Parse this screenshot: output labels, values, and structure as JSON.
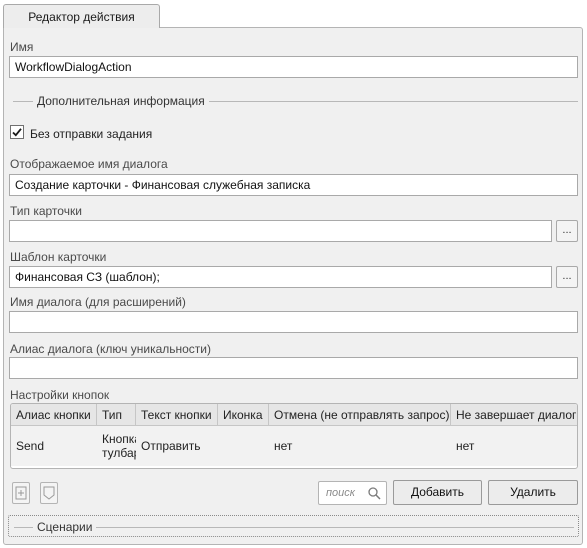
{
  "tab": {
    "label": "Редактор действия"
  },
  "name_field": {
    "label": "Имя",
    "value": "WorkflowDialogAction"
  },
  "extra_section": {
    "title": "Дополнительная информация"
  },
  "no_task_checkbox": {
    "label": "Без отправки задания",
    "checked": true
  },
  "dialog_display_name": {
    "label": "Отображаемое имя диалога",
    "value": "Создание карточки - Финансовая служебная записка"
  },
  "card_type": {
    "label": "Тип карточки",
    "value": "",
    "browse_label": "..."
  },
  "card_template": {
    "label": "Шаблон карточки",
    "value": "Финансовая СЗ (шаблон);",
    "browse_label": "..."
  },
  "dialog_name_ext": {
    "label": "Имя диалога (для расширений)",
    "value": ""
  },
  "dialog_alias": {
    "label": "Алиас диалога (ключ уникальности)",
    "value": ""
  },
  "buttons_settings": {
    "label": "Настройки кнопок",
    "columns": [
      "Алиас кнопки",
      "Тип",
      "Текст кнопки",
      "Иконка",
      "Отмена (не отправлять запрос)",
      "Не завершает диалог"
    ],
    "rows": [
      {
        "alias": "Send",
        "type": "Кнопка тулбара",
        "text": "Отправить",
        "icon": "",
        "cancel": "нет",
        "no_finish": "нет"
      }
    ]
  },
  "toolbar": {
    "add_icon": "add-row-icon",
    "remove_icon": "remove-row-icon",
    "search_placeholder": "поиск",
    "search_icon": "magnifier-icon",
    "add_label": "Добавить",
    "delete_label": "Удалить"
  },
  "scenarios_section": {
    "title": "Сценарии"
  }
}
